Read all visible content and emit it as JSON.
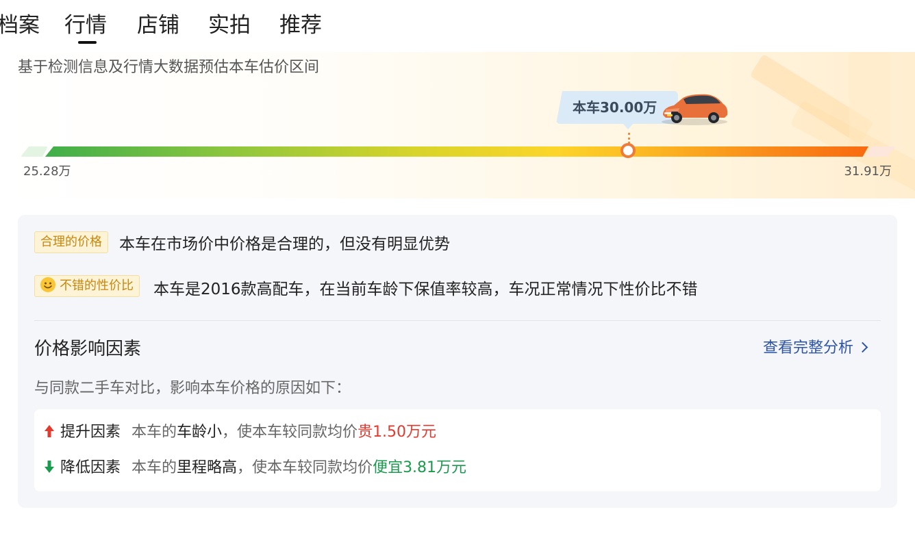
{
  "tabs": [
    {
      "label": "档案"
    },
    {
      "label": "行情"
    },
    {
      "label": "店铺"
    },
    {
      "label": "实拍"
    },
    {
      "label": "推荐"
    }
  ],
  "active_tab": "行情",
  "hero": {
    "subtitle": "基于检测信息及行情大数据预估本车估价区间",
    "callout_label": "本车30.00万",
    "min_price": "25.28万",
    "max_price": "31.91万",
    "position_fraction": 0.71
  },
  "assessment": {
    "tag1": "合理的价格",
    "line1": "本车在市场价中价格是合理的，但没有明显优势",
    "tag2": "不错的性价比",
    "line2": "本车是2016款高配车，在当前车龄下保值率较高，车况正常情况下性价比不错"
  },
  "factors": {
    "title": "价格影响因素",
    "view_link": "查看完整分析",
    "compare_text": "与同款二手车对比，影响本车价格的原因如下：",
    "rows": [
      {
        "direction": "up",
        "label": "提升因素",
        "prefix": "本车的",
        "reason": "车龄小",
        "middle": "，使本车较同款均价",
        "effect": "贵1.50万元"
      },
      {
        "direction": "down",
        "label": "降低因素",
        "prefix": "本车的",
        "reason": "里程略高",
        "middle": "，使本车较同款均价",
        "effect": "便宜3.81万元"
      }
    ]
  },
  "colors": {
    "accent_link": "#2d54a5",
    "price_up": "#e23a2e",
    "price_down": "#1a9a4c",
    "tag_text": "#c78810",
    "marker": "#f07a3a"
  },
  "icons": [
    "smile-icon",
    "arrow-up-icon",
    "arrow-down-icon",
    "chevron-right-icon",
    "car-image"
  ]
}
